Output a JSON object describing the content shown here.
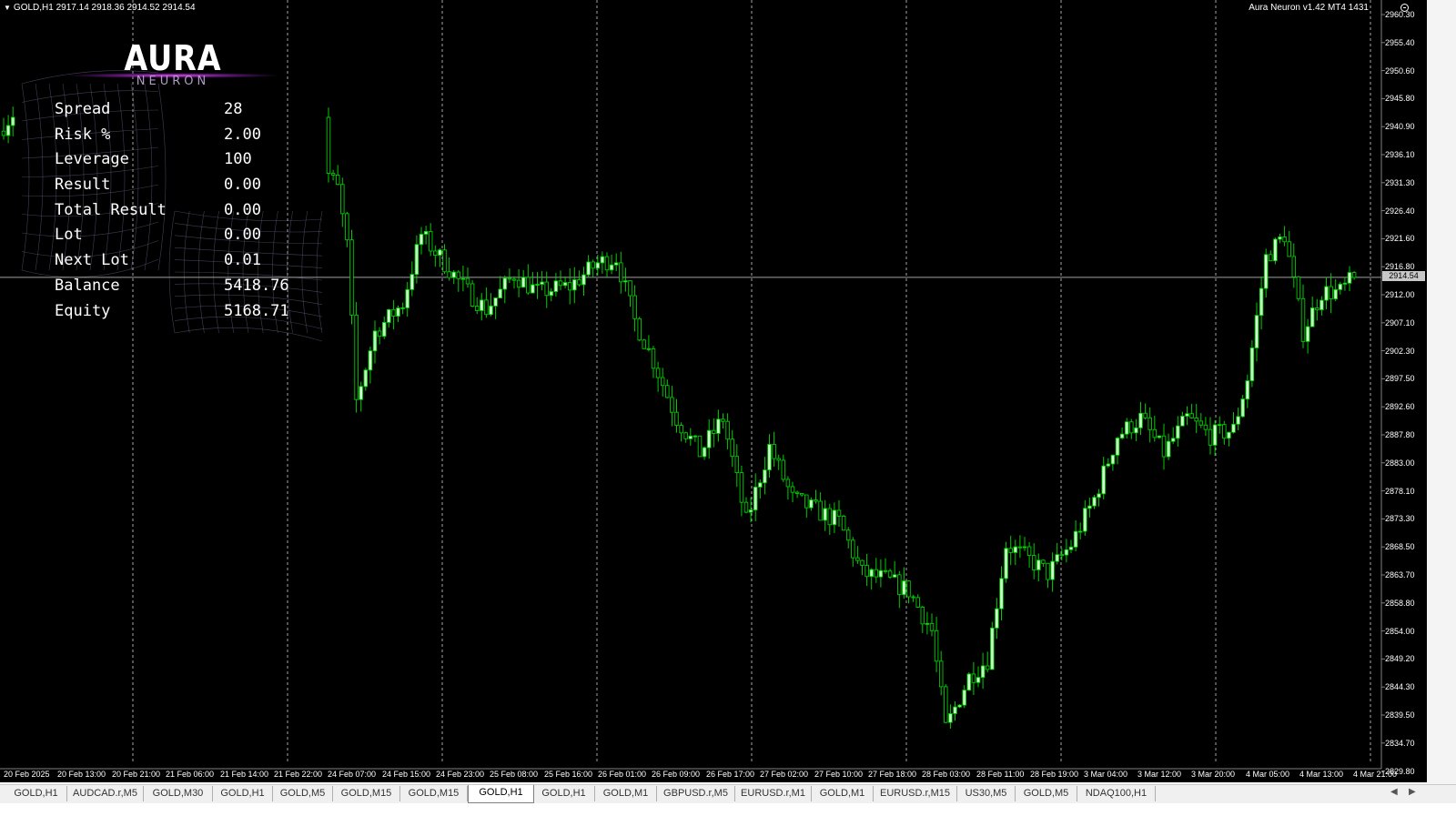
{
  "header": {
    "symbol_info": "GOLD,H1  2917.14 2918.36 2914.52 2914.54",
    "ea_label": "Aura Neuron v1.42 MT4 1431"
  },
  "logo": {
    "main": "AURA",
    "sub": "NEURON"
  },
  "stats": [
    {
      "label": "Spread",
      "value": "28"
    },
    {
      "label": "Risk %",
      "value": "2.00"
    },
    {
      "label": "Leverage",
      "value": "100"
    },
    {
      "label": "Result",
      "value": "0.00"
    },
    {
      "label": "Total Result",
      "value": "0.00"
    },
    {
      "label": "Lot",
      "value": "0.00"
    },
    {
      "label": "Next Lot",
      "value": "0.01"
    },
    {
      "label": "Balance",
      "value": "5418.76"
    },
    {
      "label": "Equity",
      "value": "5168.71"
    }
  ],
  "price_axis": {
    "labels": [
      "2960.30",
      "2955.40",
      "2950.60",
      "2945.80",
      "2940.90",
      "2936.10",
      "2931.30",
      "2926.40",
      "2921.60",
      "2916.80",
      "2912.00",
      "2907.10",
      "2902.30",
      "2897.50",
      "2892.60",
      "2887.80",
      "2883.00",
      "2878.10",
      "2873.30",
      "2868.50",
      "2863.70",
      "2858.80",
      "2854.00",
      "2849.20",
      "2844.30",
      "2839.50",
      "2834.70",
      "2829.80"
    ],
    "current": "2914.54"
  },
  "time_axis": [
    "20 Feb 2025",
    "20 Feb 13:00",
    "20 Feb 21:00",
    "21 Feb 06:00",
    "21 Feb 14:00",
    "21 Feb 22:00",
    "24 Feb 07:00",
    "24 Feb 15:00",
    "24 Feb 23:00",
    "25 Feb 08:00",
    "25 Feb 16:00",
    "26 Feb 01:00",
    "26 Feb 09:00",
    "26 Feb 17:00",
    "27 Feb 02:00",
    "27 Feb 10:00",
    "27 Feb 18:00",
    "28 Feb 03:00",
    "28 Feb 11:00",
    "28 Feb 19:00",
    "3 Mar 04:00",
    "3 Mar 12:00",
    "3 Mar 20:00",
    "4 Mar 05:00",
    "4 Mar 13:00",
    "4 Mar 21:00"
  ],
  "tabs": [
    "GOLD,H1",
    "AUDCAD.r,M5",
    "GOLD,M30",
    "GOLD,H1",
    "GOLD,M5",
    "GOLD,M15",
    "GOLD,M15",
    "GOLD,H1",
    "GOLD,H1",
    "GOLD,M1",
    "GBPUSD.r,M5",
    "EURUSD.r,M1",
    "GOLD,M1",
    "EURUSD.r,M15",
    "US30,M5",
    "GOLD,M5",
    "NDAQ100,H1"
  ],
  "active_tab_index": 7,
  "colors": {
    "background": "#000000",
    "bull_fill": "#ccffcc",
    "outline": "#00cc00",
    "grid": "#c0c0c0",
    "accent": "#e050f0"
  },
  "chart_data": {
    "type": "candlestick",
    "symbol": "GOLD",
    "timeframe": "H1",
    "ylim": [
      2829.8,
      2960.3
    ],
    "close_path": [
      [
        0,
        2941
      ],
      [
        6,
        2947
      ],
      [
        11,
        2940
      ],
      [
        22,
        2946
      ],
      [
        27,
        2955
      ],
      [
        31,
        2938
      ],
      [
        36,
        2948
      ],
      [
        41,
        2950
      ],
      [
        48,
        2951
      ],
      [
        53,
        2938
      ],
      [
        58,
        2932
      ],
      [
        63,
        2938
      ],
      [
        68,
        2935
      ],
      [
        72,
        2930
      ],
      [
        74,
        2920
      ],
      [
        76,
        2893
      ],
      [
        80,
        2905
      ],
      [
        86,
        2910
      ],
      [
        90,
        2922
      ],
      [
        95,
        2917
      ],
      [
        100,
        2912
      ],
      [
        104,
        2909
      ],
      [
        110,
        2915
      ],
      [
        115,
        2912
      ],
      [
        122,
        2913
      ],
      [
        128,
        2917
      ],
      [
        132,
        2918
      ],
      [
        136,
        2907
      ],
      [
        140,
        2900
      ],
      [
        145,
        2890
      ],
      [
        150,
        2884
      ],
      [
        155,
        2890
      ],
      [
        160,
        2872
      ],
      [
        165,
        2885
      ],
      [
        170,
        2876
      ],
      [
        175,
        2874
      ],
      [
        180,
        2872
      ],
      [
        185,
        2863
      ],
      [
        190,
        2862
      ],
      [
        195,
        2860
      ],
      [
        200,
        2853
      ],
      [
        203,
        2836
      ],
      [
        208,
        2845
      ],
      [
        212,
        2848
      ],
      [
        216,
        2868
      ],
      [
        220,
        2866
      ],
      [
        225,
        2863
      ],
      [
        230,
        2868
      ],
      [
        235,
        2876
      ],
      [
        240,
        2887
      ],
      [
        245,
        2890
      ],
      [
        250,
        2884
      ],
      [
        255,
        2890
      ],
      [
        260,
        2887
      ],
      [
        265,
        2888
      ],
      [
        268,
        2897
      ],
      [
        272,
        2918
      ],
      [
        276,
        2922
      ],
      [
        280,
        2905
      ],
      [
        284,
        2912
      ],
      [
        288,
        2912
      ],
      [
        291,
        2914.54
      ]
    ],
    "series": [
      {
        "name": "GOLD,H1",
        "last": 2914.54,
        "open": 2917.14,
        "high": 2918.36,
        "low": 2914.52
      }
    ]
  }
}
